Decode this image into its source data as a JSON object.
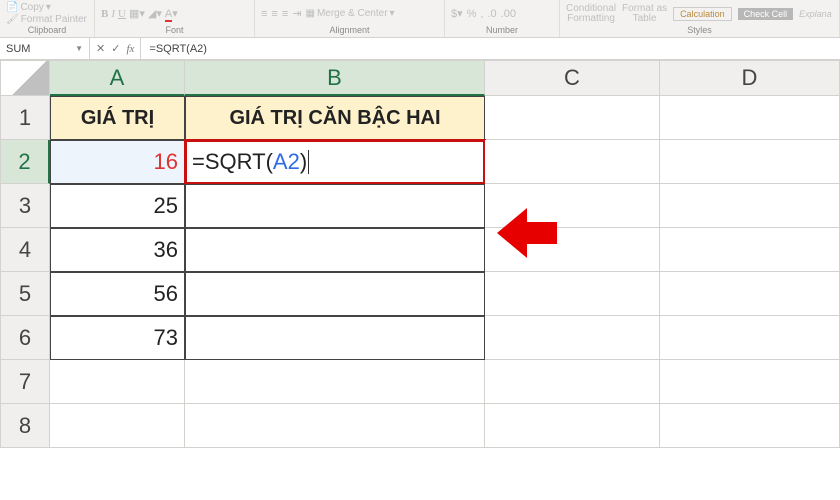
{
  "ribbon": {
    "clipboard": {
      "copy": "Copy",
      "formatPainter": "Format Painter",
      "label": "Clipboard"
    },
    "font": {
      "label": "Font"
    },
    "alignment": {
      "mergeCenter": "Merge & Center",
      "label": "Alignment"
    },
    "number": {
      "label": "Number"
    },
    "styles": {
      "conditional": "Conditional\nFormatting",
      "formatTable": "Format as\nTable",
      "calc": "Calculation",
      "checkCell": "Check Cell",
      "explan": "Explana",
      "label": "Styles"
    }
  },
  "nameBox": {
    "value": "SUM"
  },
  "formulaBar": {
    "value": "=SQRT(A2)"
  },
  "columns": [
    "A",
    "B",
    "C",
    "D"
  ],
  "rows": [
    "1",
    "2",
    "3",
    "4",
    "5",
    "6",
    "7",
    "8"
  ],
  "headers": {
    "A": "GIÁ TRỊ",
    "B": "GIÁ TRỊ CĂN BẬC HAI"
  },
  "data": {
    "A2": "16",
    "A3": "25",
    "A4": "36",
    "A5": "56",
    "A6": "73"
  },
  "editingCell": {
    "prefix": "=SQRT(",
    "ref": "A2",
    "suffix": ")"
  },
  "chart_data": {
    "type": "table",
    "title": "GIÁ TRỊ CĂN BẬC HAI",
    "columns": [
      "GIÁ TRỊ",
      "GIÁ TRỊ CĂN BẬC HAI"
    ],
    "rows": [
      [
        16,
        "=SQRT(A2)"
      ],
      [
        25,
        ""
      ],
      [
        36,
        ""
      ],
      [
        56,
        ""
      ],
      [
        73,
        ""
      ]
    ]
  }
}
